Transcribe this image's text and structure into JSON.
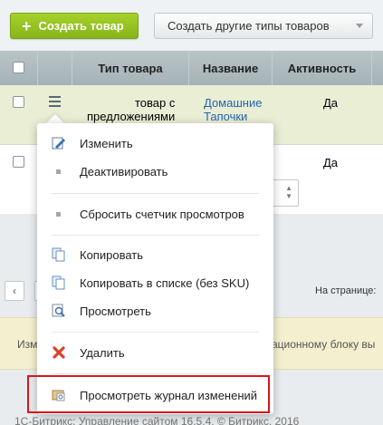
{
  "toolbar": {
    "create_label": "Создать товар",
    "create_plus": "+",
    "other_label": "Создать другие типы товаров"
  },
  "table": {
    "headers": [
      "Тип товара",
      "Название",
      "Активность"
    ],
    "rows": [
      {
        "type_line1": "товар с",
        "type_line2": "предложениями",
        "name_line1": "Домашние",
        "name_line2": "Тапочки",
        "active": "Да"
      },
      {
        "active": "Да"
      }
    ]
  },
  "pager": {
    "prev": "‹",
    "per_page_label": "На странице:"
  },
  "notice": {
    "left_text": "Изм",
    "right_text": "ационному блоку вы"
  },
  "footer": {
    "text": "1С-Битрикс: Управление сайтом 16.5.4. © Битрикс, 2016"
  },
  "menu": {
    "items": [
      {
        "label": "Изменить",
        "icon": "edit-icon"
      },
      {
        "label": "Деактивировать",
        "icon": "dot-icon"
      },
      {
        "label": "Сбросить счетчик просмотров",
        "icon": "dot-icon"
      },
      {
        "label": "Копировать",
        "icon": "copy-icon"
      },
      {
        "label": "Копировать в списке (без SKU)",
        "icon": "copy-icon"
      },
      {
        "label": "Просмотреть",
        "icon": "view-icon"
      },
      {
        "label": "Удалить",
        "icon": "delete-icon"
      },
      {
        "label": "Просмотреть журнал изменений",
        "icon": "history-icon"
      }
    ]
  },
  "colors": {
    "accent_green": "#8fbd1f",
    "link_blue": "#2067b0",
    "highlight_red": "#d7161d"
  }
}
